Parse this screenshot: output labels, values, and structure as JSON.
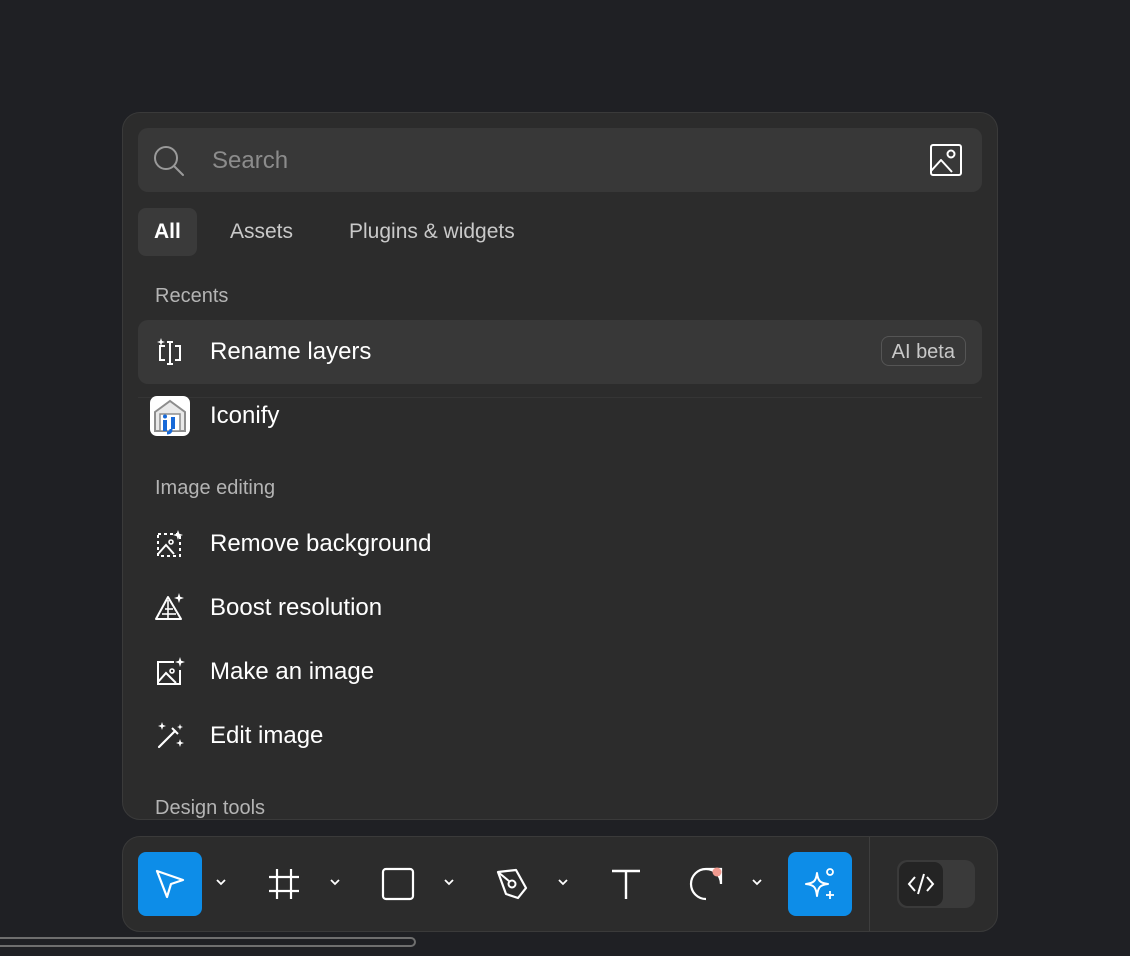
{
  "search": {
    "placeholder": "Search",
    "value": ""
  },
  "tabs": [
    {
      "label": "All",
      "active": true
    },
    {
      "label": "Assets",
      "active": false
    },
    {
      "label": "Plugins & widgets",
      "active": false
    }
  ],
  "sections": {
    "recents": {
      "title": "Recents",
      "items": [
        {
          "label": "Rename layers",
          "badge": "AI beta",
          "icon": "rename-layers-icon"
        },
        {
          "label": "Iconify",
          "icon": "iconify-logo"
        }
      ]
    },
    "image_editing": {
      "title": "Image editing",
      "items": [
        {
          "label": "Remove background",
          "icon": "remove-background-icon"
        },
        {
          "label": "Boost resolution",
          "icon": "boost-resolution-icon"
        },
        {
          "label": "Make an image",
          "icon": "make-image-icon"
        },
        {
          "label": "Edit image",
          "icon": "magic-wand-icon"
        }
      ]
    },
    "design_tools": {
      "title": "Design tools"
    }
  },
  "toolbar": {
    "tools": [
      {
        "name": "move-tool",
        "icon": "cursor-arrow-icon",
        "active": true
      },
      {
        "name": "frame-tool",
        "icon": "frame-hash-icon"
      },
      {
        "name": "shape-tool",
        "icon": "rectangle-icon"
      },
      {
        "name": "pen-tool",
        "icon": "pen-nib-icon"
      },
      {
        "name": "text-tool",
        "icon": "text-t-icon"
      },
      {
        "name": "comment-tool",
        "icon": "comment-bubble-icon"
      },
      {
        "name": "actions-tool",
        "icon": "ai-sparkle-icon",
        "active": true
      },
      {
        "name": "dev-mode-toggle",
        "icon": "code-brackets-icon"
      }
    ]
  },
  "colors": {
    "background": "#1f2024",
    "panel": "#2c2c2c",
    "highlight": "#383838",
    "accent_blue": "#0d8de8",
    "notification_dot": "#f19a8f",
    "text_primary": "#ffffff",
    "text_secondary": "#b4b4b4"
  }
}
